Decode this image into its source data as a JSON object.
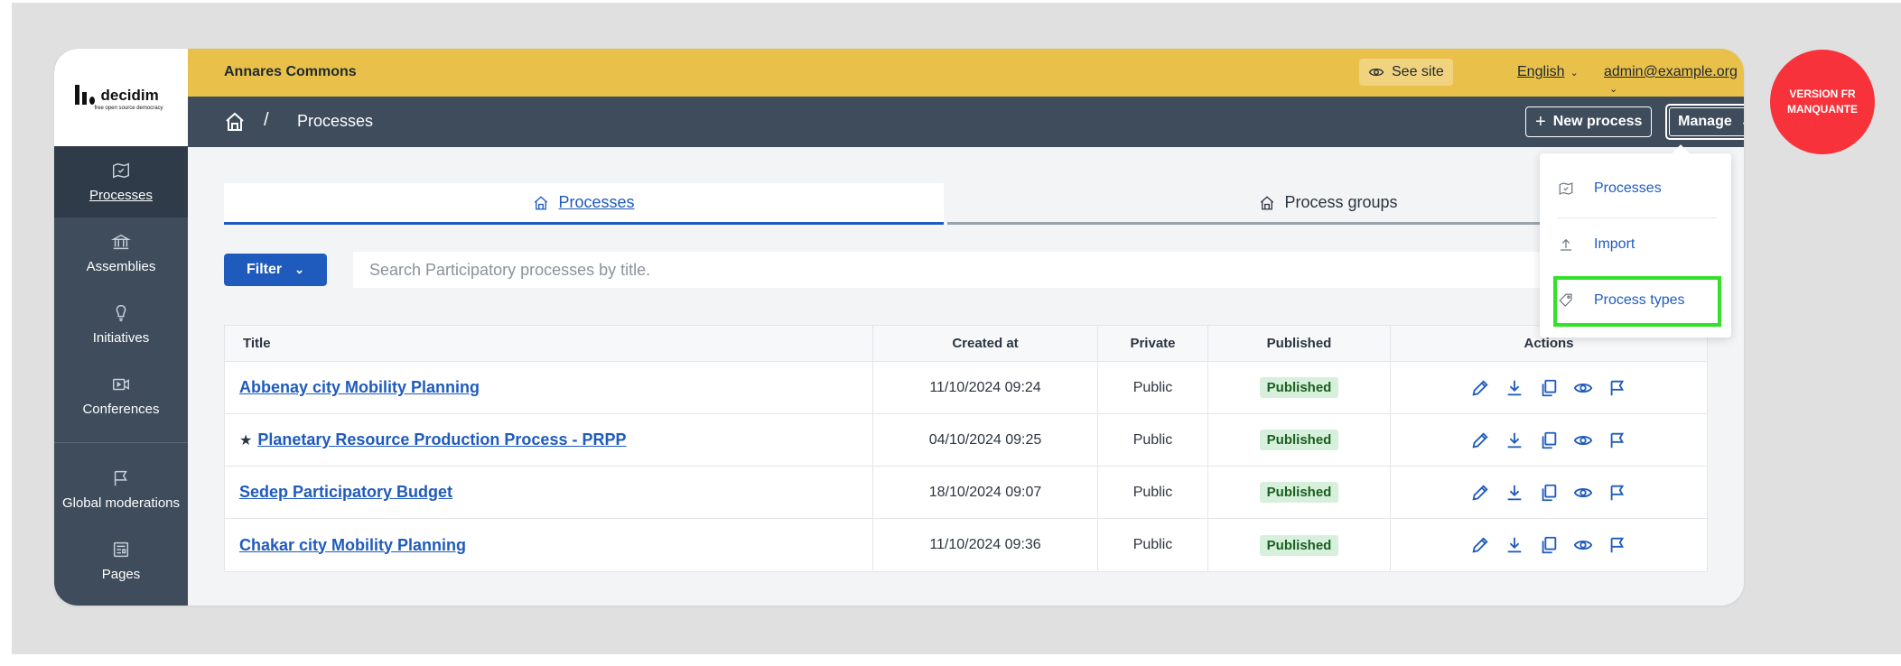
{
  "sidebar": {
    "items": [
      {
        "label": "Processes",
        "icon": "processes-icon",
        "active": true
      },
      {
        "label": "Assemblies",
        "icon": "assemblies-icon"
      },
      {
        "label": "Initiatives",
        "icon": "initiatives-icon"
      },
      {
        "label": "Conferences",
        "icon": "conferences-icon"
      }
    ],
    "bottom_items": [
      {
        "label": "Global moderations",
        "icon": "flag-icon"
      },
      {
        "label": "Pages",
        "icon": "pages-icon"
      }
    ]
  },
  "topbar": {
    "org_name": "Annares Commons",
    "see_site": "See site",
    "language": "English",
    "user": "admin@example.org"
  },
  "subbar": {
    "breadcrumb_sep": "/",
    "breadcrumb_current": "Processes",
    "new_process": "New process",
    "manage": "Manage"
  },
  "tabs": [
    {
      "label": "Processes",
      "active": true
    },
    {
      "label": "Process groups"
    }
  ],
  "filter": {
    "label": "Filter"
  },
  "search": {
    "placeholder": "Search Participatory processes by title."
  },
  "table": {
    "headers": {
      "title": "Title",
      "created": "Created at",
      "private": "Private",
      "published": "Published",
      "actions": "Actions"
    },
    "rows": [
      {
        "title": "Abbenay city Mobility Planning",
        "starred": false,
        "created": "11/10/2024 09:24",
        "private": "Public",
        "published": "Published"
      },
      {
        "title": "Planetary Resource Production Process - PRPP",
        "starred": true,
        "created": "04/10/2024 09:25",
        "private": "Public",
        "published": "Published"
      },
      {
        "title": "Sedep Participatory Budget",
        "starred": false,
        "created": "18/10/2024 09:07",
        "private": "Public",
        "published": "Published"
      },
      {
        "title": "Chakar city Mobility Planning",
        "starred": false,
        "created": "11/10/2024 09:36",
        "private": "Public",
        "published": "Published"
      }
    ],
    "star_glyph": "★"
  },
  "manage_menu": {
    "items": [
      {
        "label": "Processes",
        "icon": "processes-icon"
      },
      {
        "label": "Import",
        "icon": "upload-icon"
      },
      {
        "label": "Process types",
        "icon": "tag-icon"
      }
    ]
  },
  "annotation": {
    "badge_text": "VERSION FR MANQUANTE",
    "highlight_color": "#33e02a",
    "badge_color": "#f7323a"
  },
  "colors": {
    "topbar": "#e9c14a",
    "sidebar": "#3e4c5c",
    "accent": "#1f5bbd",
    "published_badge_bg": "#d6f0db"
  }
}
